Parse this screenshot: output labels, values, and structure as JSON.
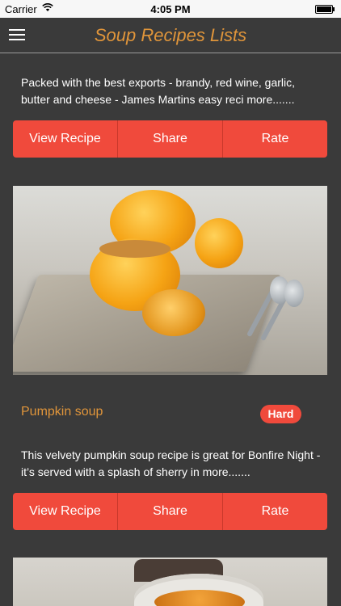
{
  "status_bar": {
    "carrier": "Carrier",
    "time": "4:05 PM"
  },
  "nav": {
    "title": "Soup Recipes Lists",
    "menu_icon": "hamburger-menu-icon"
  },
  "recipes": [
    {
      "description": "Packed with the best exports - brandy, red wine, garlic, butter and cheese - James Martins easy reci more.......",
      "actions": {
        "view": "View Recipe",
        "share": "Share",
        "rate": "Rate"
      }
    },
    {
      "title": "Pumpkin soup",
      "difficulty": "Hard",
      "description": "This velvety pumpkin soup recipe is great for Bonfire Night - it’s served with a splash of sherry in more.......",
      "actions": {
        "view": "View Recipe",
        "share": "Share",
        "rate": "Rate"
      }
    }
  ],
  "colors": {
    "background": "#3a3a3a",
    "accent": "#e0953a",
    "button": "#f04a3c"
  }
}
